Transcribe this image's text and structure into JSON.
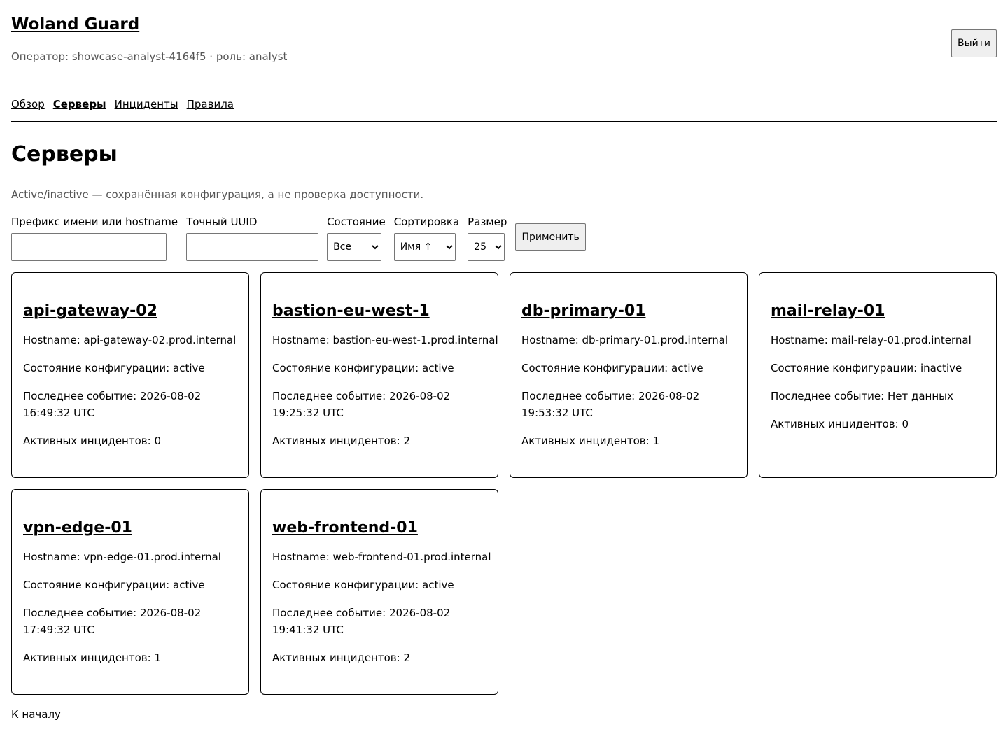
{
  "header": {
    "brand": "Woland Guard",
    "operator": "Оператор: showcase-analyst-4164f5 · роль: analyst",
    "logout_label": "Выйти"
  },
  "nav": {
    "items": [
      {
        "label": "Обзор",
        "active": false
      },
      {
        "label": "Серверы",
        "active": true
      },
      {
        "label": "Инциденты",
        "active": false
      },
      {
        "label": "Правила",
        "active": false
      }
    ]
  },
  "main": {
    "title": "Серверы",
    "note": "Active/inactive — сохранённая конфигурация, а не проверка доступности."
  },
  "filters": {
    "prefix_label": "Префикс имени или hostname",
    "prefix_value": "",
    "uuid_label": "Точный UUID",
    "uuid_value": "",
    "state_label": "Состояние",
    "state_value": "Все",
    "sort_label": "Сортировка",
    "sort_value": "Имя ↑",
    "size_label": "Размер",
    "size_value": "25",
    "apply_label": "Применить"
  },
  "servers": [
    {
      "name": "api-gateway-02",
      "hostname": "Hostname: api-gateway-02.prod.internal",
      "state": "Состояние конфигурации: active",
      "last_event": "Последнее событие: 2026-08-02 16:49:32 UTC",
      "incidents": "Активных инцидентов: 0"
    },
    {
      "name": "bastion-eu-west-1",
      "hostname": "Hostname: bastion-eu-west-1.prod.internal",
      "state": "Состояние конфигурации: active",
      "last_event": "Последнее событие: 2026-08-02 19:25:32 UTC",
      "incidents": "Активных инцидентов: 2"
    },
    {
      "name": "db-primary-01",
      "hostname": "Hostname: db-primary-01.prod.internal",
      "state": "Состояние конфигурации: active",
      "last_event": "Последнее событие: 2026-08-02 19:53:32 UTC",
      "incidents": "Активных инцидентов: 1"
    },
    {
      "name": "mail-relay-01",
      "hostname": "Hostname: mail-relay-01.prod.internal",
      "state": "Состояние конфигурации: inactive",
      "last_event": "Последнее событие: Нет данных",
      "incidents": "Активных инцидентов: 0"
    },
    {
      "name": "vpn-edge-01",
      "hostname": "Hostname: vpn-edge-01.prod.internal",
      "state": "Состояние конфигурации: active",
      "last_event": "Последнее событие: 2026-08-02 17:49:32 UTC",
      "incidents": "Активных инцидентов: 1"
    },
    {
      "name": "web-frontend-01",
      "hostname": "Hostname: web-frontend-01.prod.internal",
      "state": "Состояние конфигурации: active",
      "last_event": "Последнее событие: 2026-08-02 19:41:32 UTC",
      "incidents": "Активных инцидентов: 2"
    }
  ],
  "footer": {
    "back_label": "К началу"
  }
}
